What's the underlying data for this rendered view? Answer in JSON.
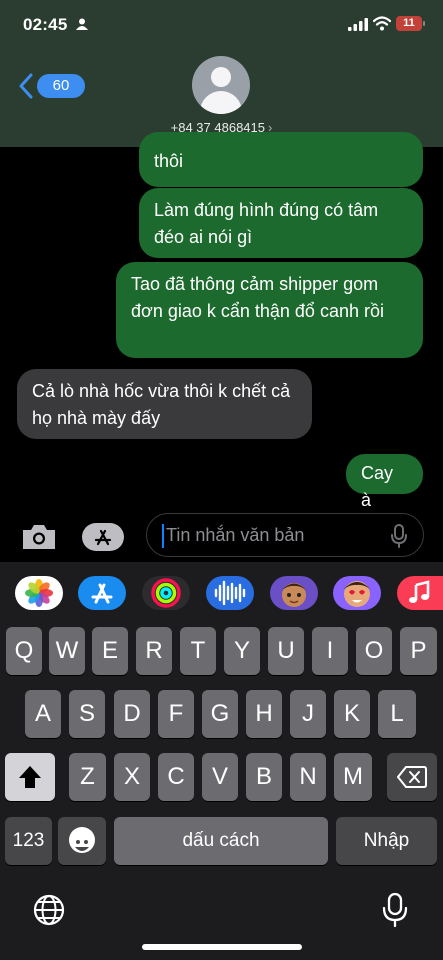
{
  "status_bar": {
    "time": "02:45",
    "battery": "11"
  },
  "header": {
    "back_count": "60",
    "contact": "+84 37 4868415",
    "chevron": "›"
  },
  "messages": [
    {
      "dir": "out",
      "text": "thôi"
    },
    {
      "dir": "out",
      "text": "Làm đúng hình đúng có tâm đéo ai nói gì"
    },
    {
      "dir": "out",
      "text": "Tao đã thông cảm shipper gom đơn giao k cẩn thận đổ canh rồi"
    },
    {
      "dir": "in",
      "text": "Cả lò nhà hốc vừa thôi k chết cả họ nhà mày đấy"
    },
    {
      "dir": "out",
      "text": "Cay à"
    }
  ],
  "input": {
    "placeholder": "Tin nhắn văn bản"
  },
  "apps": [
    "photos-icon",
    "app-store-icon",
    "fitness-icon",
    "audio-icon",
    "memoji-icon",
    "memoji-icon",
    "music-icon"
  ],
  "keyboard": {
    "row1": [
      "Q",
      "W",
      "E",
      "R",
      "T",
      "Y",
      "U",
      "I",
      "O",
      "P"
    ],
    "row2": [
      "A",
      "S",
      "D",
      "F",
      "G",
      "H",
      "J",
      "K",
      "L"
    ],
    "row3": [
      "Z",
      "X",
      "C",
      "V",
      "B",
      "N",
      "M"
    ],
    "numbers": "123",
    "space": "dấu cách",
    "return": "Nhập"
  },
  "colors": {
    "header": "#2b3d30",
    "outgoing": "#1c6a2e",
    "incoming": "#3a3a3d",
    "accent": "#3d8ef0"
  }
}
